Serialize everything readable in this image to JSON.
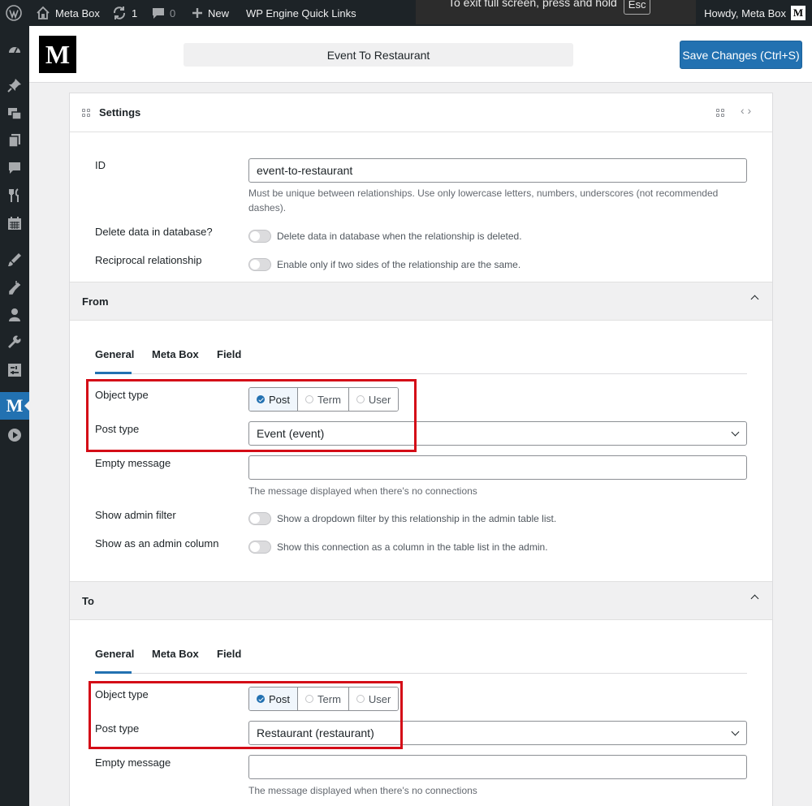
{
  "admin_bar": {
    "site_name": "Meta Box",
    "updates_count": "1",
    "comments_count": "0",
    "new_label": "New",
    "quick_links": "WP Engine Quick Links",
    "fullscreen_notice": "To exit full screen, press and hold",
    "fullscreen_key": "Esc",
    "howdy": "Howdy, Meta Box",
    "avatar_letter": "M"
  },
  "sidebar": {
    "items": [
      "dashboard-icon",
      "pin-icon",
      "media-icon",
      "pages-icon",
      "comments-icon",
      "restaurant-icon",
      "calendar-icon",
      "appearance-icon",
      "plugins-icon",
      "users-icon",
      "tools-icon",
      "settings-icon",
      "metabox-icon",
      "play-icon"
    ],
    "active": "metabox-icon",
    "metabox_letter": "M"
  },
  "header": {
    "logo_letter": "M",
    "title": "Event To Restaurant",
    "save_label": "Save Changes (Ctrl+S)",
    "accent": "#2271b1"
  },
  "settings": {
    "heading": "Settings",
    "id_label": "ID",
    "id_value": "event-to-restaurant",
    "id_desc": "Must be unique between relationships. Use only lowercase letters, numbers, underscores (not recommended dashes).",
    "delete_label": "Delete data in database?",
    "delete_desc": "Delete data in database when the relationship is deleted.",
    "reciprocal_label": "Reciprocal relationship",
    "reciprocal_desc": "Enable only if two sides of the relationship are the same."
  },
  "from": {
    "heading": "From",
    "tabs": [
      "General",
      "Meta Box",
      "Field"
    ],
    "object_type_label": "Object type",
    "object_types": [
      "Post",
      "Term",
      "User"
    ],
    "selected_object_type": "Post",
    "post_type_label": "Post type",
    "post_type_value": "Event (event)",
    "empty_message_label": "Empty message",
    "empty_message_value": "",
    "empty_message_desc": "The message displayed when there's no connections",
    "admin_filter_label": "Show admin filter",
    "admin_filter_desc": "Show a dropdown filter by this relationship in the admin table list.",
    "admin_column_label": "Show as an admin column",
    "admin_column_desc": "Show this connection as a column in the table list in the admin."
  },
  "to": {
    "heading": "To",
    "tabs": [
      "General",
      "Meta Box",
      "Field"
    ],
    "object_type_label": "Object type",
    "object_types": [
      "Post",
      "Term",
      "User"
    ],
    "selected_object_type": "Post",
    "post_type_label": "Post type",
    "post_type_value": "Restaurant (restaurant)",
    "empty_message_label": "Empty message",
    "empty_message_value": "",
    "empty_message_desc": "The message displayed when there's no connections"
  },
  "highlight_color": "#d40c17"
}
